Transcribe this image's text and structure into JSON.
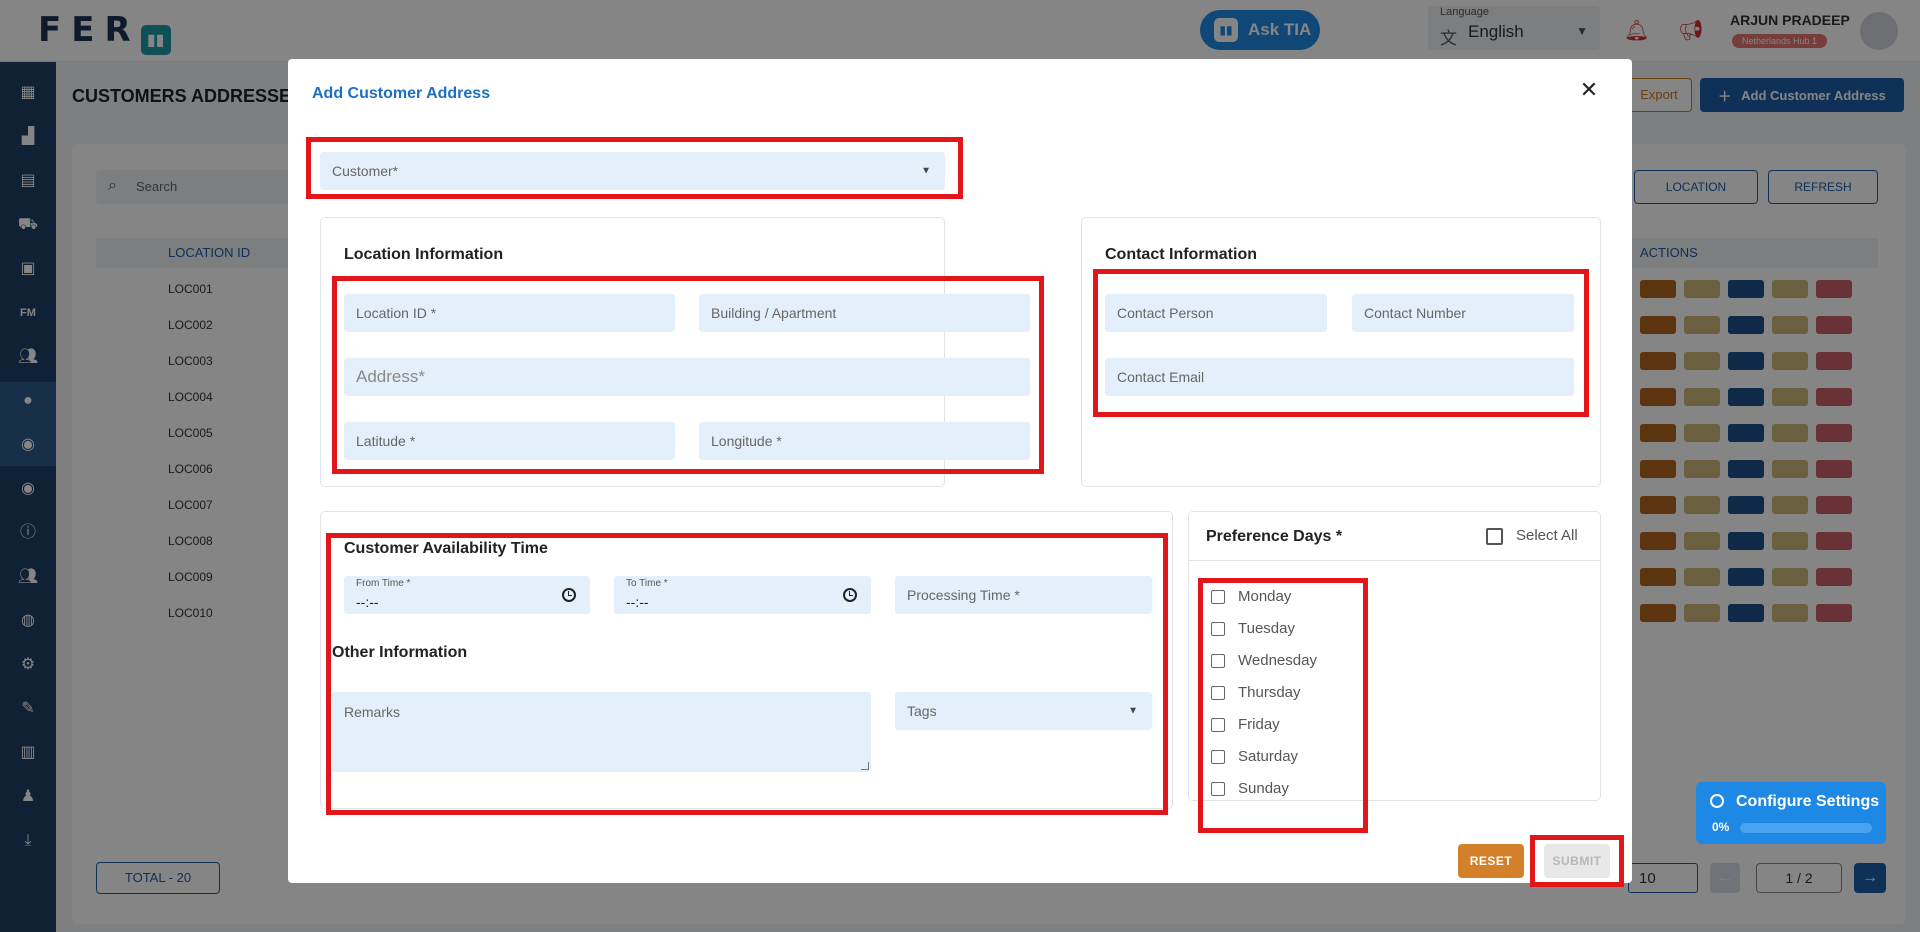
{
  "header": {
    "logo_text": "FER",
    "ask_tia": "Ask TIA",
    "language_label": "Language",
    "language_value": "English",
    "user_name": "ARJUN PRADEEP",
    "hub": "Netherlands Hub 1"
  },
  "page": {
    "title": "CUSTOMERS ADDRESSES",
    "export": "Export",
    "add_customer_address": "Add Customer Address",
    "search_placeholder": "Search",
    "location_btn": "LOCATION",
    "refresh_btn": "REFRESH",
    "col_location_id": "LOCATION ID",
    "col_actions": "ACTIONS",
    "rows": [
      "LOC001",
      "LOC002",
      "LOC003",
      "LOC004",
      "LOC005",
      "LOC006",
      "LOC007",
      "LOC008",
      "LOC009",
      "LOC010"
    ],
    "total": "TOTAL  - 20",
    "page_size": "10",
    "page_indicator": "1  /  2"
  },
  "config_widget": {
    "title": "Configure Settings",
    "percent": "0%"
  },
  "modal": {
    "title": "Add Customer Address",
    "customer_placeholder": "Customer*",
    "location_info": {
      "title": "Location Information",
      "location_id": "Location ID *",
      "building": "Building / Apartment",
      "address": "Address*",
      "latitude": "Latitude *",
      "longitude": "Longitude *"
    },
    "contact_info": {
      "title": "Contact Information",
      "contact_person": "Contact Person",
      "contact_number": "Contact Number",
      "contact_email": "Contact Email"
    },
    "availability": {
      "title": "Customer Availability Time",
      "from_label": "From Time *",
      "from_value": "--:--",
      "to_label": "To Time *",
      "to_value": "--:--",
      "processing_time": "Processing Time *"
    },
    "other_info": {
      "title": "Other Information",
      "remarks": "Remarks",
      "tags": "Tags"
    },
    "preference": {
      "title": "Preference Days *",
      "select_all": "Select All",
      "days": [
        "Monday",
        "Tuesday",
        "Wednesday",
        "Thursday",
        "Friday",
        "Saturday",
        "Sunday"
      ]
    },
    "reset": "RESET",
    "submit": "SUBMIT"
  },
  "colors": {
    "primary": "#1d5fa8",
    "highlight": "#e0161b",
    "field_bg": "#e3f0fb",
    "reset": "#d4802a"
  }
}
